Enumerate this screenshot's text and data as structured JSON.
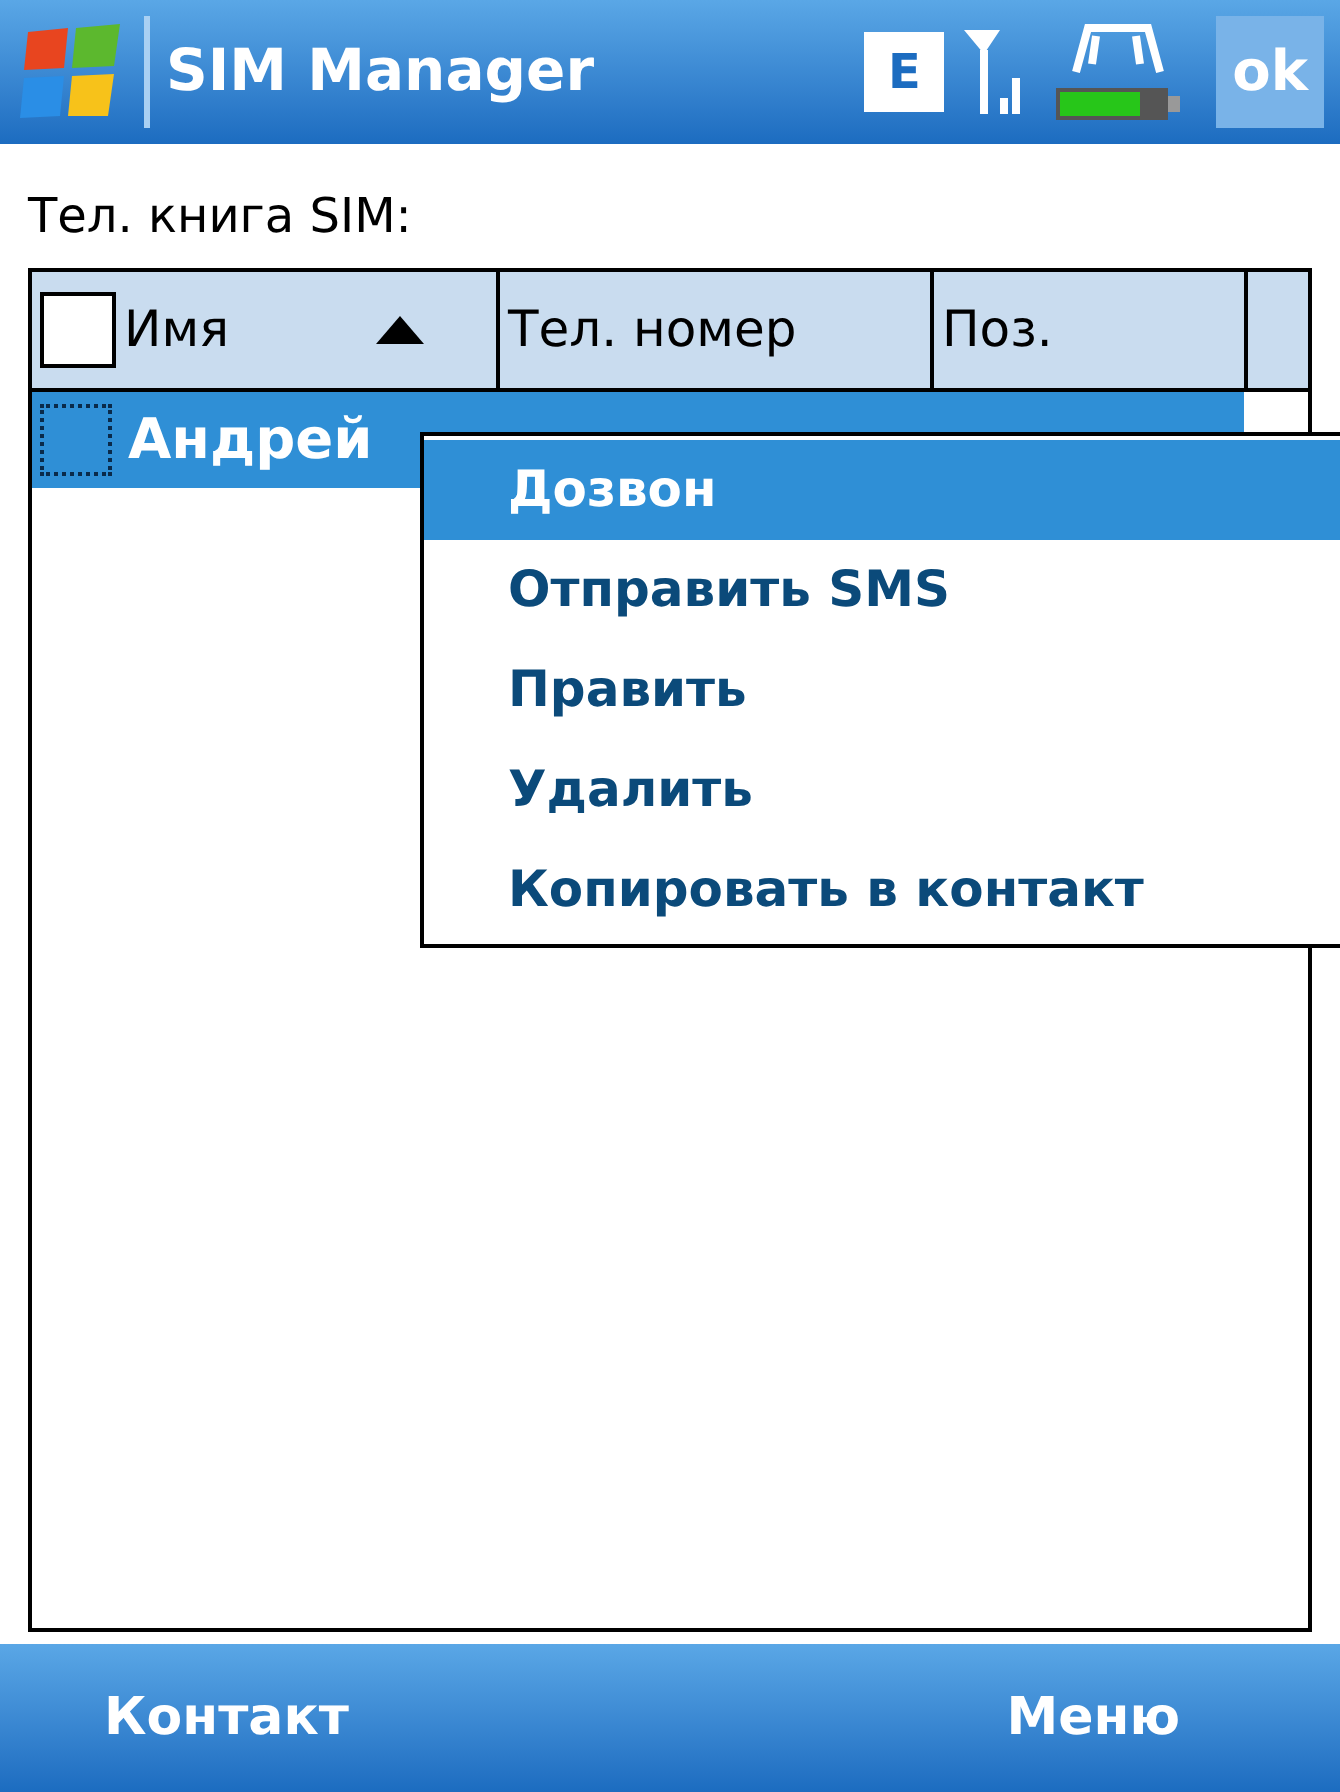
{
  "title_bar": {
    "title": "SIM Manager",
    "network_badge": "E",
    "ok_button": "ok"
  },
  "list_label": "Тел. книга SIM:",
  "table": {
    "header_checked": false,
    "columns": [
      {
        "label": "Имя",
        "sorted": true
      },
      {
        "label": "Тел. номер",
        "sorted": false
      },
      {
        "label": "Поз.",
        "sorted": false
      }
    ],
    "rows": [
      {
        "name": "Андрей",
        "selected": true,
        "checked": false
      }
    ]
  },
  "context_menu": [
    {
      "label": "Дозвон",
      "selected": true
    },
    {
      "label": "Отправить SMS",
      "selected": false
    },
    {
      "label": "Править",
      "selected": false
    },
    {
      "label": "Удалить",
      "selected": false
    },
    {
      "label": "Копировать в контакт",
      "selected": false
    }
  ],
  "soft_keys": {
    "left": "Контакт",
    "right": "Меню"
  }
}
